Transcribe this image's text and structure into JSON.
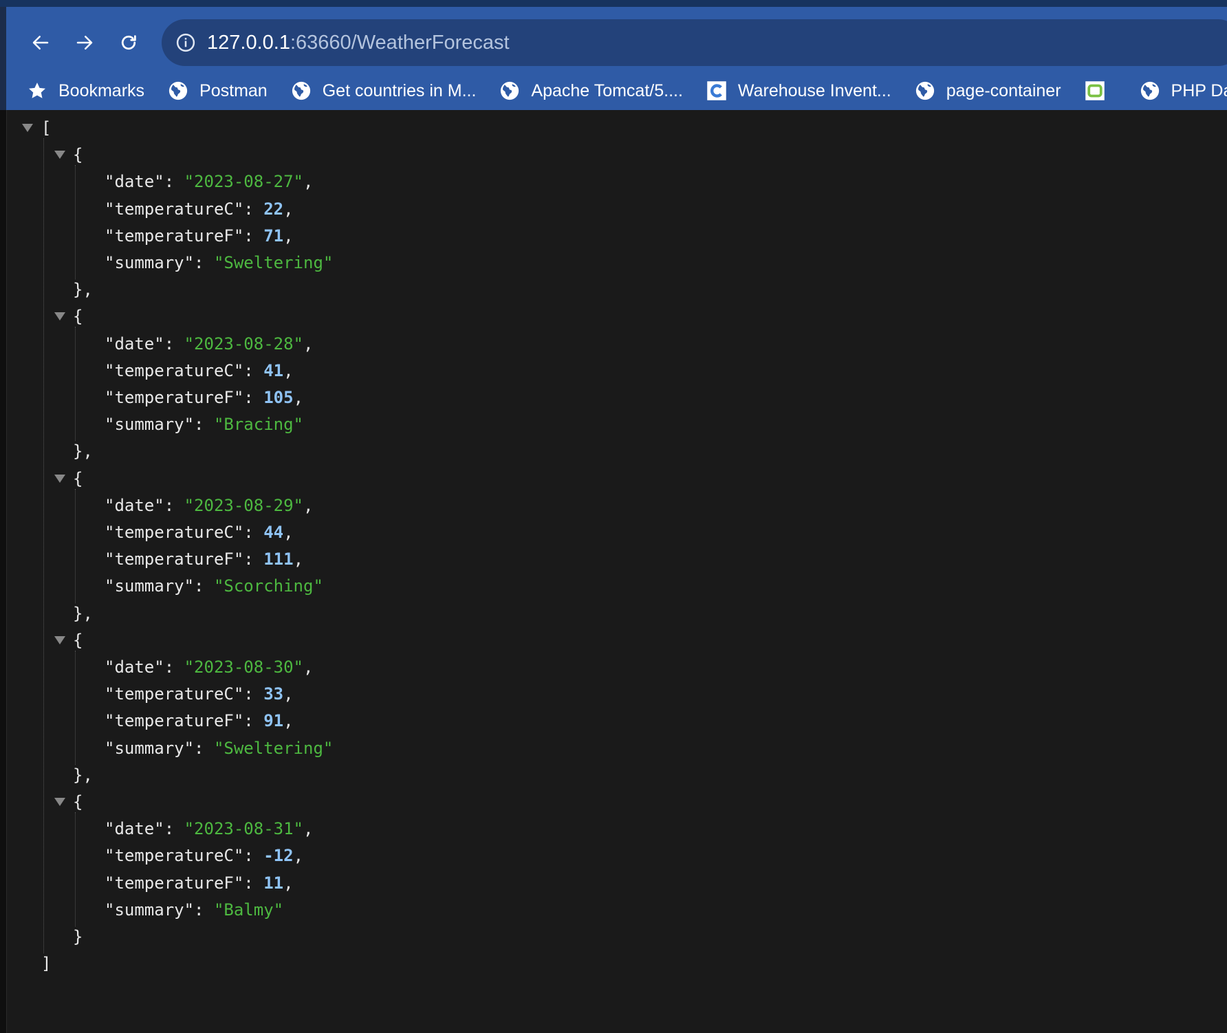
{
  "browser": {
    "url_host": "127.0.0.1",
    "url_rest": ":63660/WeatherForecast",
    "bookmarks": [
      {
        "label": "Bookmarks",
        "icon": "star-icon"
      },
      {
        "label": "Postman",
        "icon": "globe-icon"
      },
      {
        "label": "Get countries in M...",
        "icon": "globe-icon"
      },
      {
        "label": "Apache Tomcat/5....",
        "icon": "globe-icon"
      },
      {
        "label": "Warehouse Invent...",
        "icon": "c-logo-icon"
      },
      {
        "label": "page-container",
        "icon": "globe-icon"
      },
      {
        "label": "",
        "icon": "green-square-icon"
      },
      {
        "label": "PHP Da",
        "icon": "globe-icon"
      }
    ]
  },
  "json": {
    "open_bracket": "[",
    "close_bracket": "]",
    "items": [
      {
        "date": "\"2023-08-27\"",
        "temperatureC": "22",
        "temperatureF": "71",
        "summary": "\"Sweltering\""
      },
      {
        "date": "\"2023-08-28\"",
        "temperatureC": "41",
        "temperatureF": "105",
        "summary": "\"Bracing\""
      },
      {
        "date": "\"2023-08-29\"",
        "temperatureC": "44",
        "temperatureF": "111",
        "summary": "\"Scorching\""
      },
      {
        "date": "\"2023-08-30\"",
        "temperatureC": "33",
        "temperatureF": "91",
        "summary": "\"Sweltering\""
      },
      {
        "date": "\"2023-08-31\"",
        "temperatureC": "-12",
        "temperatureF": "11",
        "summary": "\"Balmy\""
      }
    ],
    "keys": {
      "date": "\"date\"",
      "temperatureC": "\"temperatureC\"",
      "temperatureF": "\"temperatureF\"",
      "summary": "\"summary\""
    }
  },
  "colors": {
    "chrome": "#2f5ba6",
    "omnibox": "#23427a",
    "background": "#1a1a1a",
    "string": "#4db840",
    "number": "#8fc3f4"
  }
}
